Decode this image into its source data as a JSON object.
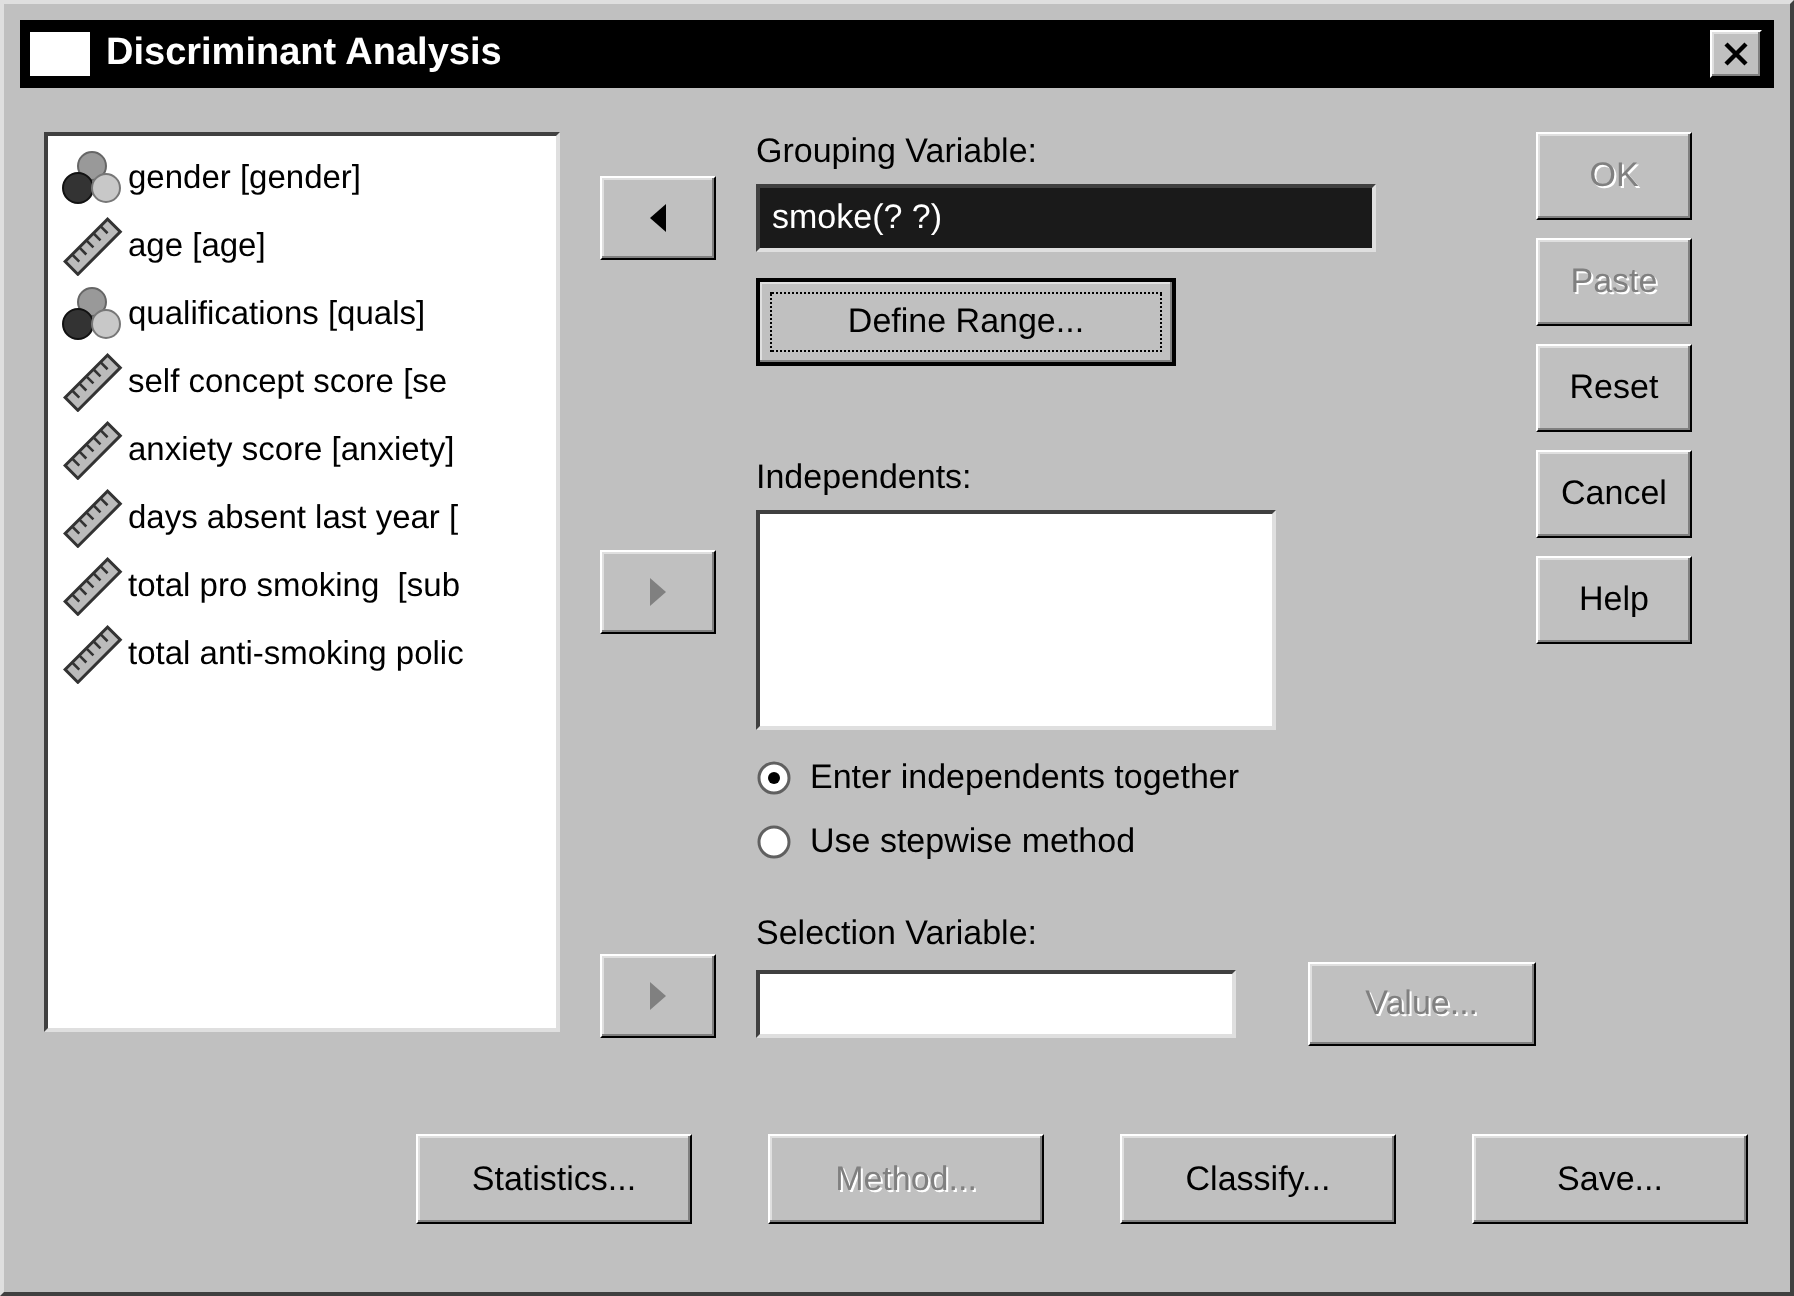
{
  "window": {
    "title": "Discriminant Analysis"
  },
  "variables": [
    {
      "name": "gender [gender]",
      "kind": "nominal"
    },
    {
      "name": "age [age]",
      "kind": "scale"
    },
    {
      "name": "qualifications [quals]",
      "kind": "nominal"
    },
    {
      "name": "self concept score [se",
      "kind": "scale"
    },
    {
      "name": "anxiety score [anxiety]",
      "kind": "scale"
    },
    {
      "name": "days absent last year [",
      "kind": "scale"
    },
    {
      "name": "total pro smoking  [sub",
      "kind": "scale"
    },
    {
      "name": "total anti-smoking polic",
      "kind": "scale"
    }
  ],
  "move_buttons": [
    {
      "kind": "left",
      "disabled": false
    },
    {
      "kind": "right",
      "disabled": true
    },
    {
      "kind": "right",
      "disabled": true
    }
  ],
  "grouping": {
    "label": "Grouping Variable:",
    "value": "smoke(? ?)",
    "selected": true,
    "define_range": {
      "label": "Define Range...",
      "focused": true
    }
  },
  "independents": {
    "label": "Independents:"
  },
  "methods": [
    {
      "label": "Enter independents together",
      "selected": true
    },
    {
      "label": "Use stepwise method",
      "selected": false
    }
  ],
  "selection": {
    "label": "Selection Variable:",
    "value_button": {
      "label": "Value...",
      "disabled": true
    }
  },
  "side_buttons": [
    {
      "label": "OK",
      "disabled": true
    },
    {
      "label": "Paste",
      "disabled": true
    },
    {
      "label": "Reset",
      "disabled": false
    },
    {
      "label": "Cancel",
      "disabled": false
    },
    {
      "label": "Help",
      "disabled": false
    }
  ],
  "bottom_buttons": [
    {
      "label": "Statistics...",
      "disabled": false
    },
    {
      "label": "Method...",
      "disabled": true
    },
    {
      "label": "Classify...",
      "disabled": false
    },
    {
      "label": "Save...",
      "disabled": false
    }
  ]
}
